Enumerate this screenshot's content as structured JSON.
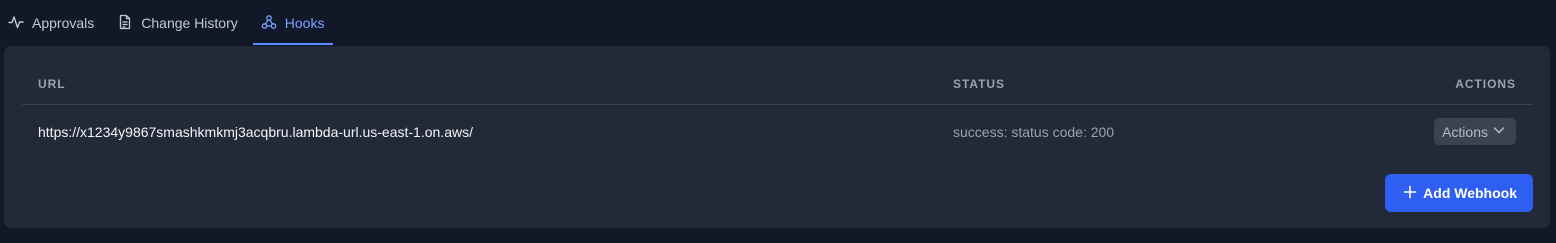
{
  "tabs": [
    {
      "label": "Approvals",
      "icon": "activity-icon",
      "active": false
    },
    {
      "label": "Change History",
      "icon": "document-icon",
      "active": false
    },
    {
      "label": "Hooks",
      "icon": "webhook-icon",
      "active": true
    }
  ],
  "table": {
    "headers": {
      "url": "URL",
      "status": "STATUS",
      "actions": "ACTIONS"
    },
    "rows": [
      {
        "url": "https://x1234y9867smashkmkmj3acqbru.lambda-url.us-east-1.on.aws/",
        "status": "success: status code: 200",
        "actions_label": "Actions"
      }
    ]
  },
  "add_webhook_label": "Add Webhook",
  "colors": {
    "background": "#111827",
    "panel": "#222938",
    "accent": "#2f5ef3",
    "active_tab": "#7aa2ff"
  }
}
